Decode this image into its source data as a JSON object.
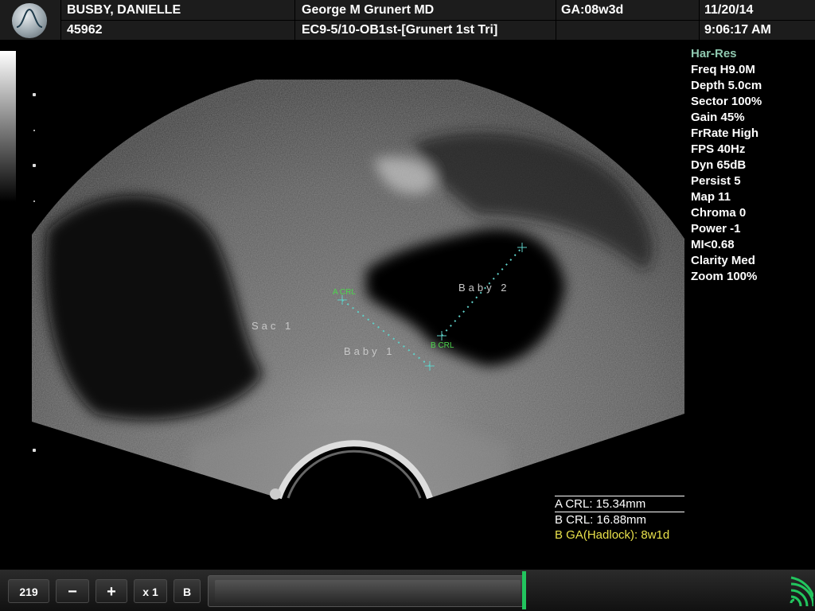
{
  "header": {
    "patient_name": "BUSBY, DANIELLE",
    "patient_id": "45962",
    "physician": "George M Grunert MD",
    "exam": "EC9-5/10-OB1st-[Grunert 1st Tri]",
    "ga": "GA:08w3d",
    "date": "11/20/14",
    "time": "9:06:17 AM"
  },
  "params": [
    "Har-Res",
    "Freq H9.0M",
    "Depth 5.0cm",
    "Sector 100%",
    "Gain 45%",
    "FrRate High",
    "FPS 40Hz",
    "Dyn 65dB",
    "Persist 5",
    "Map 11",
    "Chroma 0",
    "Power -1",
    "MI<0.68",
    "Clarity Med",
    "Zoom 100%"
  ],
  "annotations": {
    "sac": "Sac 1",
    "baby1": "Baby 1",
    "baby2": "Baby 2",
    "a_crl": "A CRL",
    "b_crl": "B CRL"
  },
  "measurements": {
    "a_crl": "A CRL: 15.34mm",
    "b_crl": "B CRL: 16.88mm",
    "b_ga": "B GA(Hadlock): 8w1d"
  },
  "footer": {
    "counter": "219",
    "minus": "−",
    "plus": "+",
    "speed": "x 1",
    "mode": "B"
  },
  "colors": {
    "accent": "#2f9e7a",
    "caliper": "#5fd0c8",
    "caliper_label": "#4cd64c",
    "ga_text": "#e9e14b"
  }
}
